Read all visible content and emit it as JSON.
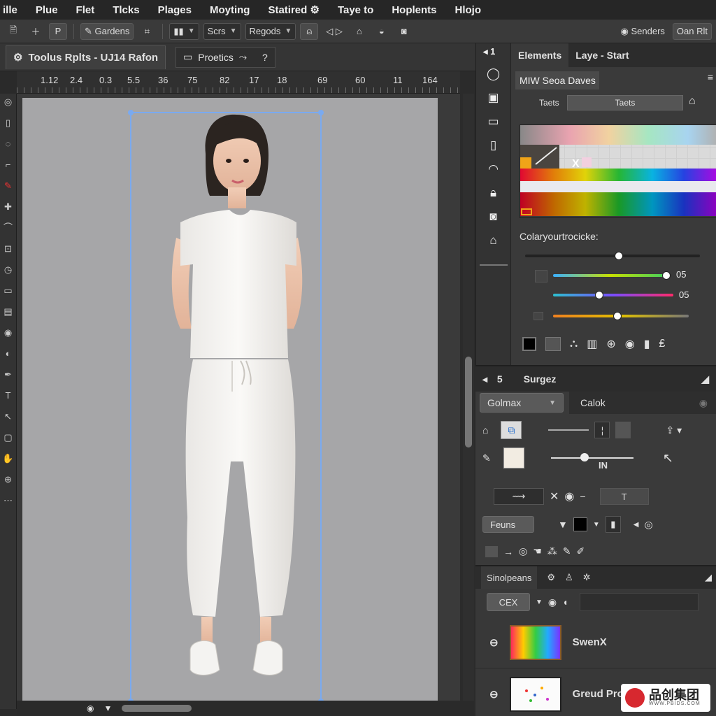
{
  "menu": [
    "ille",
    "Plue",
    "Flet",
    "Tlcks",
    "Plages",
    "Moyting",
    "Statired",
    "Taye to",
    "Hoplents",
    "Hlojo"
  ],
  "menu_icon_after_statired": "gear-icon",
  "options": {
    "brush_label": "Gardens",
    "mode_value": "Scrs",
    "blend_value": "Regods",
    "sample_label": "Senders",
    "right_label": "Oan Rlt"
  },
  "document": {
    "tab_title": "Toolus Rplts - UJ14 Rafon",
    "second_tab": "Proetics"
  },
  "ruler_numbers": [
    "1.12",
    "2.4",
    "0.3",
    "5.5",
    "36",
    "75",
    "82",
    "17",
    "18",
    "69",
    "60",
    "11",
    "164"
  ],
  "mid_column_header": "1",
  "panel_top": {
    "tabs": [
      "Elements",
      "Laye - Start"
    ],
    "title": "MIW Seoa Daves",
    "field_label": "Taets",
    "field_value": "Taets",
    "swatch_mark": "X",
    "color_label": "Colaryourtrocicke:",
    "slider_values": [
      "05",
      "05"
    ]
  },
  "panel_mid": {
    "header_number": "5",
    "header_title": "Surgez",
    "combo_left": "Golmax",
    "combo_right": "Calok",
    "in_label": "IN",
    "frames_button": "Feuns",
    "text_tool": "T"
  },
  "panel_layers": {
    "tab_label": "Sinolpeans",
    "search_button": "CEX",
    "layers": [
      {
        "name": "SwenX",
        "thumb": "spectrum"
      },
      {
        "name": "Greud Proclect",
        "thumb": "dots"
      }
    ]
  },
  "scroll": {
    "vertical_position": 0.45
  },
  "watermark": {
    "title": "品创集团",
    "url": "WWW.PBIDS.COM"
  },
  "colors": {
    "accent": "#7aaaf0",
    "panel": "#3a3a3a",
    "canvas": "#a6a6a8"
  }
}
